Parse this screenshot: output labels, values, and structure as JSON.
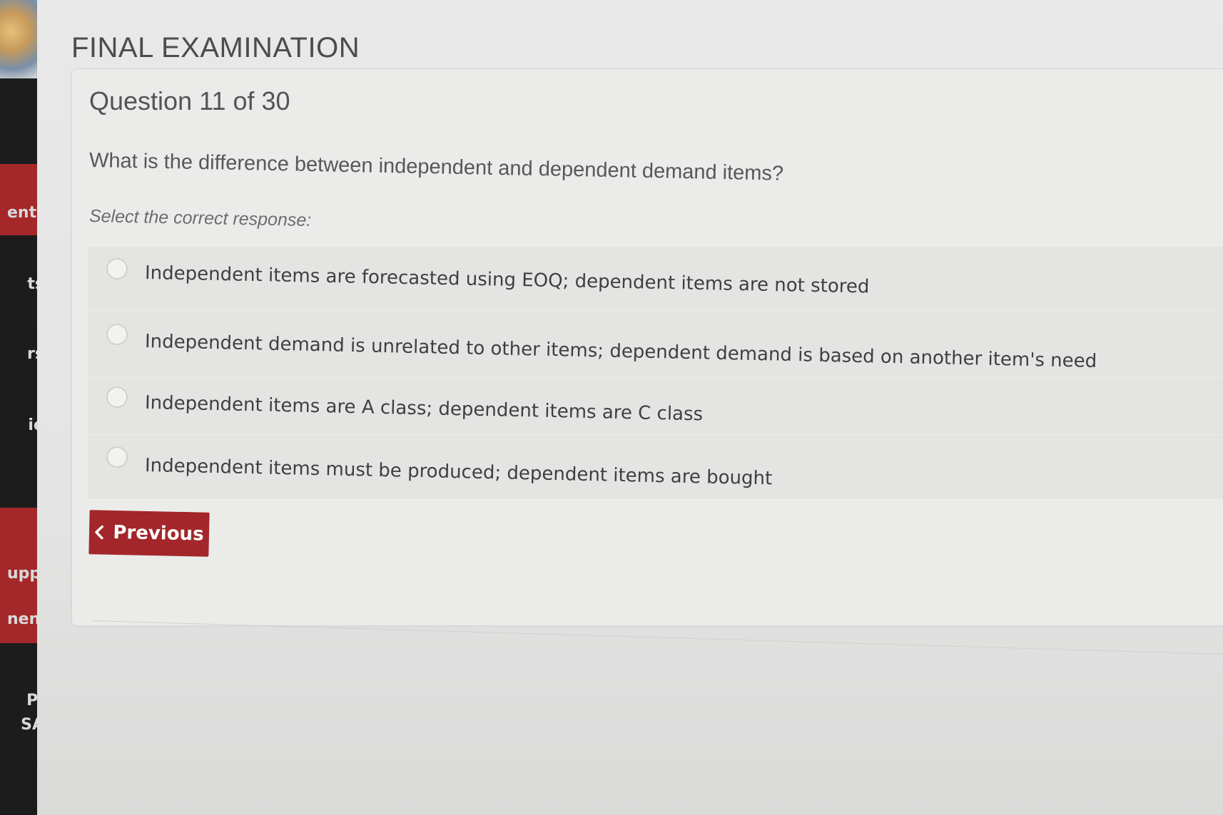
{
  "page": {
    "title": "FINAL EXAMINATION"
  },
  "sidebar": {
    "items": [
      {
        "label": "ents"
      },
      {
        "label": "ts"
      },
      {
        "label": "rs"
      },
      {
        "label": "io"
      },
      {
        "label": "upply"
      },
      {
        "label": "nent"
      },
      {
        "label": "P-"
      },
      {
        "label": "SA"
      }
    ]
  },
  "question": {
    "number_label": "Question 11 of 30",
    "text": "What is the difference between independent and dependent demand items?",
    "instruction": "Select the correct response:",
    "options": [
      {
        "label": "Independent items are forecasted using EOQ; dependent items are not stored",
        "selected": false
      },
      {
        "label": "Independent demand is unrelated to other items; dependent demand is based on another item's need",
        "selected": false
      },
      {
        "label": "Independent items are A class; dependent items are C class",
        "selected": false
      },
      {
        "label": "Independent items must be produced; dependent items are bought",
        "selected": false
      }
    ]
  },
  "navigation": {
    "previous_label": "Previous"
  },
  "colors": {
    "accent": "#a3262a",
    "sidebar": "#1c1c1c",
    "background": "#e4e5e4"
  },
  "icons": {
    "previous": "chevron-left-icon",
    "radio": "radio-unchecked-icon"
  }
}
